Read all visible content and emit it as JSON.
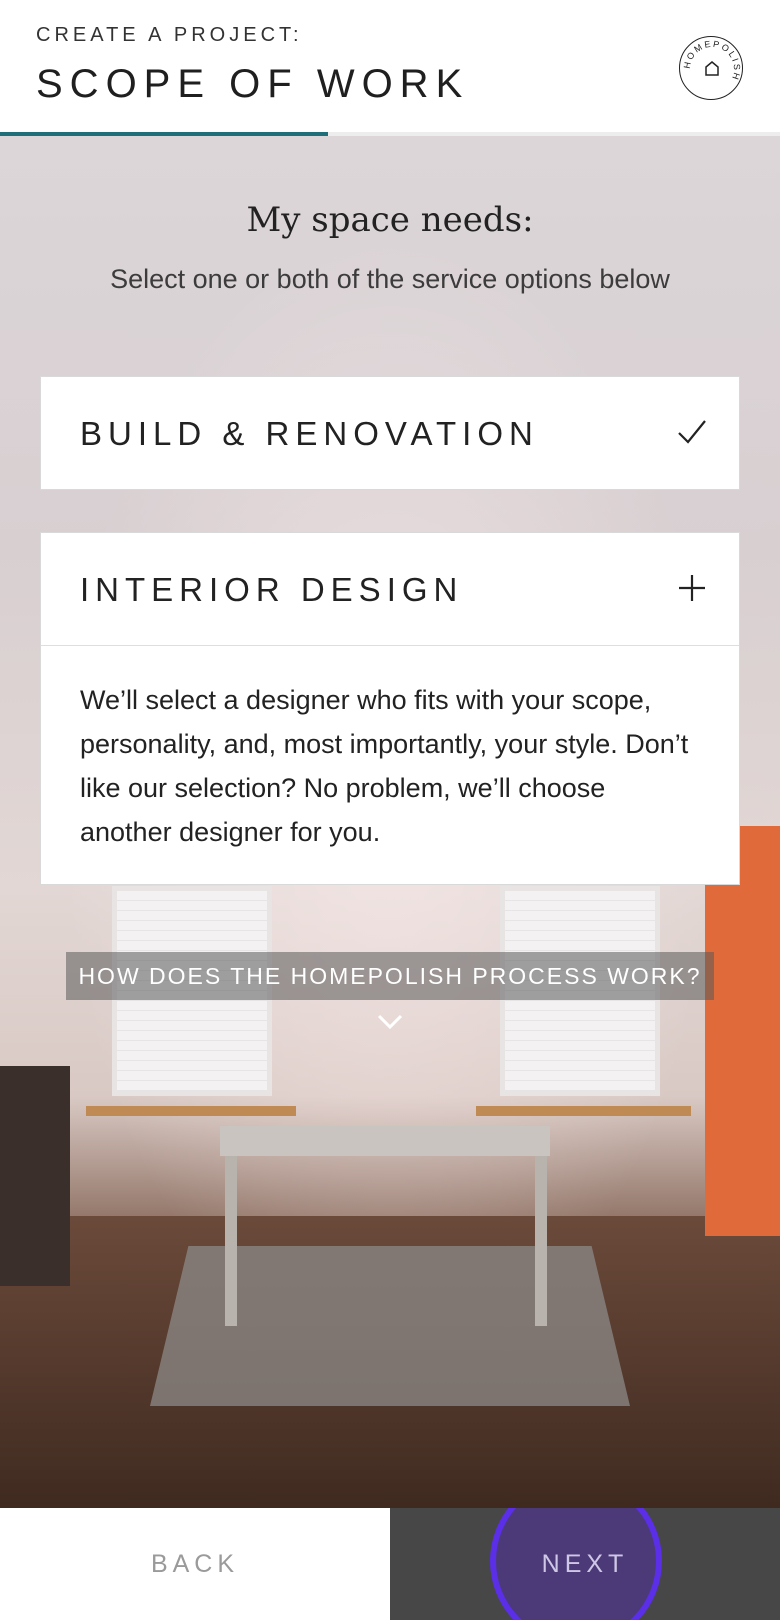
{
  "header": {
    "eyebrow": "CREATE A PROJECT:",
    "title": "SCOPE OF WORK",
    "logo_text": "HOMEPOLISH",
    "progress": 0.42,
    "accent_color": "#1f6f7a"
  },
  "main": {
    "heading": "My space needs:",
    "subheading": "Select one or both of the service options below",
    "options": [
      {
        "label": "BUILD & RENOVATION",
        "icon": "checkmark-icon",
        "selected": true
      },
      {
        "label": "INTERIOR DESIGN",
        "icon": "plus-icon",
        "expanded": true,
        "description": "We’ll select a designer who fits with your scope, personality, and, most importantly, your style. Don’t like our selection? No problem, we’ll choose another designer for you."
      }
    ],
    "process_link": "HOW DOES THE HOMEPOLISH PROCESS WORK?"
  },
  "footer": {
    "back_label": "BACK",
    "next_label": "NEXT"
  }
}
